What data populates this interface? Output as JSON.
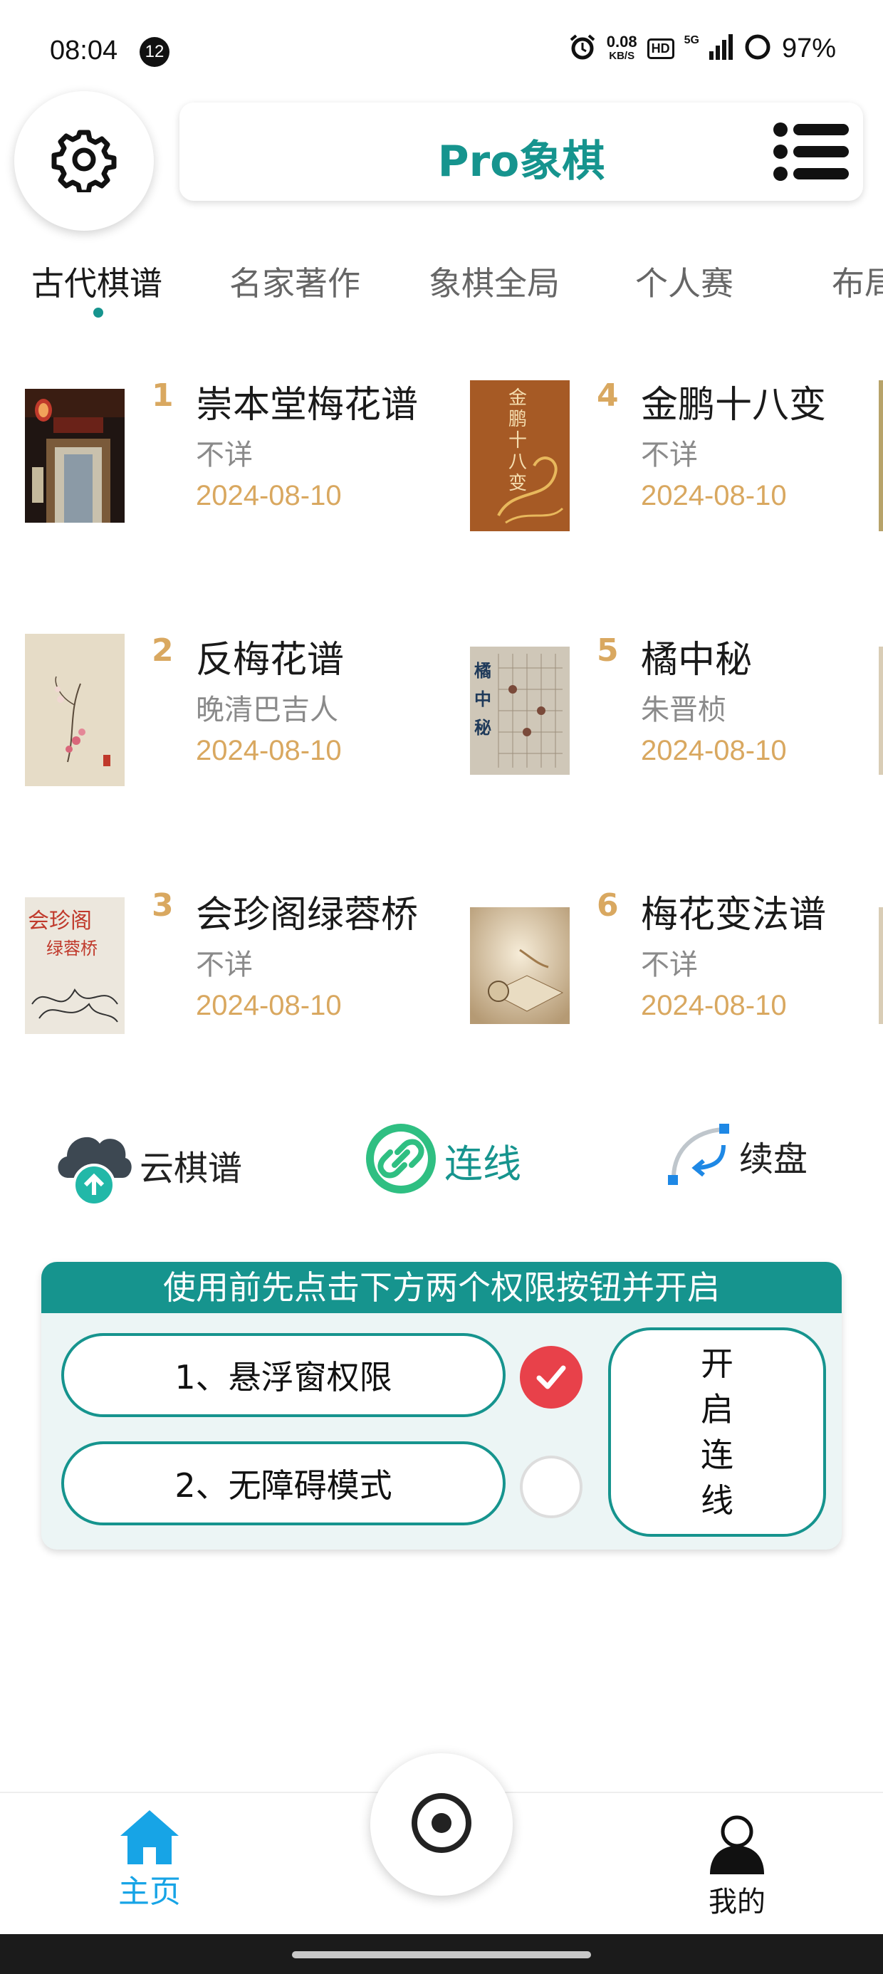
{
  "status_bar": {
    "time": "08:04",
    "notification_count": "12",
    "net_speed": "0.08",
    "net_unit": "KB/S",
    "hd": "HD",
    "network": "5G",
    "battery": "97%"
  },
  "header": {
    "title": "Pro象棋"
  },
  "tabs": [
    {
      "label": "古代棋谱",
      "active": true
    },
    {
      "label": "名家著作",
      "active": false
    },
    {
      "label": "象棋全局",
      "active": false
    },
    {
      "label": "个人赛",
      "active": false
    },
    {
      "label": "布局",
      "active": false
    }
  ],
  "books": [
    {
      "rank": "1",
      "title": "崇本堂梅花谱",
      "author": "不详",
      "date": "2024-08-10"
    },
    {
      "rank": "2",
      "title": "反梅花谱",
      "author": "晚清巴吉人",
      "date": "2024-08-10"
    },
    {
      "rank": "3",
      "title": "会珍阁绿蓉桥",
      "author": "不详",
      "date": "2024-08-10"
    },
    {
      "rank": "4",
      "title": "金鹏十八变",
      "author": "不详",
      "date": "2024-08-10"
    },
    {
      "rank": "5",
      "title": "橘中秘",
      "author": "朱晋桢",
      "date": "2024-08-10"
    },
    {
      "rank": "6",
      "title": "梅花变法谱",
      "author": "不详",
      "date": "2024-08-10"
    }
  ],
  "cover_texts": {
    "jinpeng": "金鹏十八变",
    "juzhongmi": "橘中秘",
    "huizhenge_top": "会珍阁",
    "huizhenge_sub": "绿蓉桥"
  },
  "quick_actions": {
    "cloud": "云棋谱",
    "connect": "连线",
    "resume": "续盘"
  },
  "permission_panel": {
    "header": "使用前先点击下方两个权限按钮并开启",
    "floating_window": "1、悬浮窗权限",
    "accessibility": "2、无障碍模式",
    "floating_window_enabled": true,
    "accessibility_enabled": false,
    "start_button": "开启连线"
  },
  "bottom_nav": {
    "home": "主页",
    "me": "我的"
  },
  "colors": {
    "accent": "#16948e",
    "date": "#d9a860",
    "nav_active": "#17a4e6",
    "check": "#e8414a"
  }
}
